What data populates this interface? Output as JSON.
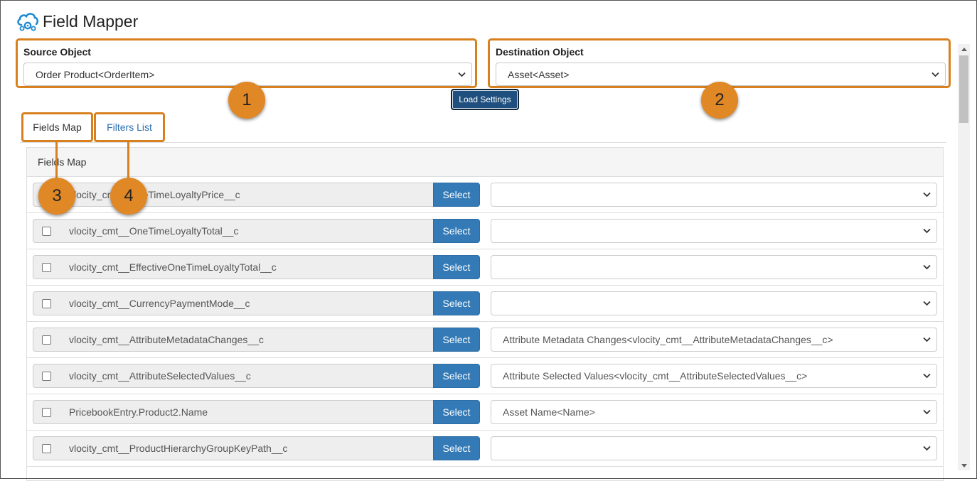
{
  "app": {
    "title": "Field Mapper",
    "logo_icon": "cloud-gear-icon"
  },
  "source": {
    "label": "Source Object",
    "value": "Order Product<OrderItem>"
  },
  "destination": {
    "label": "Destination Object",
    "value": "Asset<Asset>"
  },
  "load_settings_label": "Load Settings",
  "callouts": [
    "1",
    "2",
    "3",
    "4"
  ],
  "tabs": [
    {
      "label": "Fields Map",
      "active": true
    },
    {
      "label": "Filters List",
      "active": false
    }
  ],
  "panel_heading": "Fields Map",
  "rows": [
    {
      "field": "vlocity_cmt__OneTimeLoyaltyPrice__c",
      "select_label": "Select",
      "destination": ""
    },
    {
      "field": "vlocity_cmt__OneTimeLoyaltyTotal__c",
      "select_label": "Select",
      "destination": ""
    },
    {
      "field": "vlocity_cmt__EffectiveOneTimeLoyaltyTotal__c",
      "select_label": "Select",
      "destination": ""
    },
    {
      "field": "vlocity_cmt__CurrencyPaymentMode__c",
      "select_label": "Select",
      "destination": ""
    },
    {
      "field": "vlocity_cmt__AttributeMetadataChanges__c",
      "select_label": "Select",
      "destination": "Attribute Metadata Changes<vlocity_cmt__AttributeMetadataChanges__c>"
    },
    {
      "field": "vlocity_cmt__AttributeSelectedValues__c",
      "select_label": "Select",
      "destination": "Attribute Selected Values<vlocity_cmt__AttributeSelectedValues__c>"
    },
    {
      "field": "PricebookEntry.Product2.Name",
      "select_label": "Select",
      "destination": "Asset Name<Name>"
    },
    {
      "field": "vlocity_cmt__ProductHierarchyGroupKeyPath__c",
      "select_label": "Select",
      "destination": ""
    }
  ],
  "colors": {
    "callout": "#e08726",
    "highlight_border": "#d8801e",
    "select_button": "#337ab7",
    "load_button": "#1f4f7e",
    "link": "#2a6fb0"
  }
}
